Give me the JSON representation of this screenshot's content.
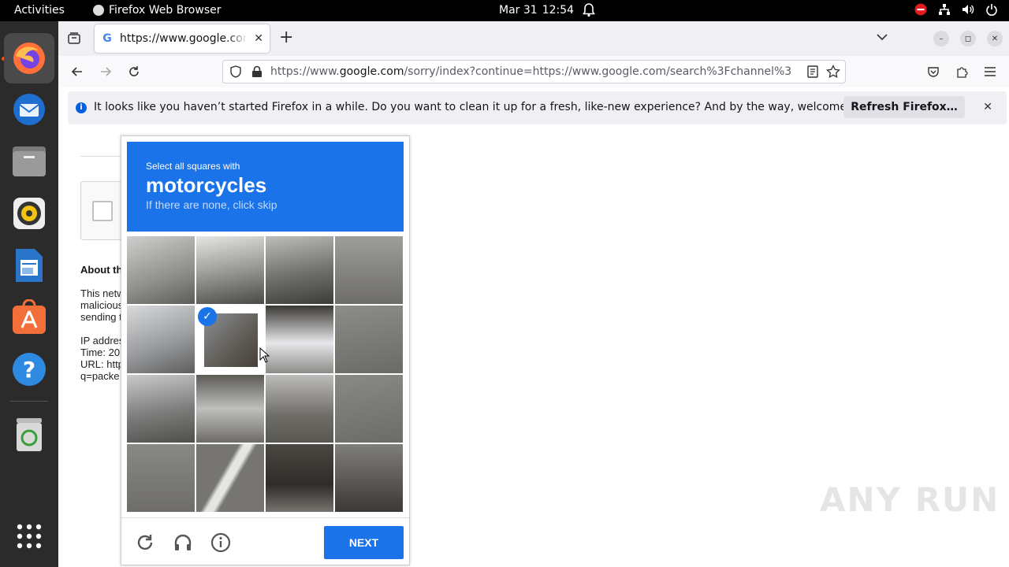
{
  "topbar": {
    "activities": "Activities",
    "app_name": "Firefox Web Browser",
    "date": "Mar 31",
    "time": "12:54"
  },
  "dock": {
    "items": [
      "firefox-icon",
      "thunderbird-icon",
      "files-icon",
      "rhythmbox-icon",
      "libreoffice-writer-icon",
      "app-center-icon",
      "help-icon",
      "trash-icon",
      "show-apps-icon"
    ]
  },
  "tab": {
    "title": "https://www.google.com/sorry/index?continue"
  },
  "urlbar": {
    "url_prefix": "https://www.",
    "url_domain": "google.com",
    "url_rest": "/sorry/index?continue=https://www.google.com/search%3Fchannel%3"
  },
  "notice": {
    "message": "It looks like you haven’t started Firefox in a while. Do you want to clean it up for a fresh, like-new experience? And by the way, welcome back!",
    "refresh_label": "Refresh Firefox…"
  },
  "page": {
    "about": "About th",
    "para1": [
      "This netw",
      "malicious",
      "sending t"
    ],
    "para2": [
      "IP addres",
      "Time: 20",
      "URL: http",
      "q=packe"
    ]
  },
  "captcha": {
    "instruction": "Select all squares with",
    "target": "motorcycles",
    "hint": "If there are none, click skip",
    "next_label": "NEXT",
    "selected_tiles": [
      5
    ]
  },
  "watermark": "ANY RUN"
}
